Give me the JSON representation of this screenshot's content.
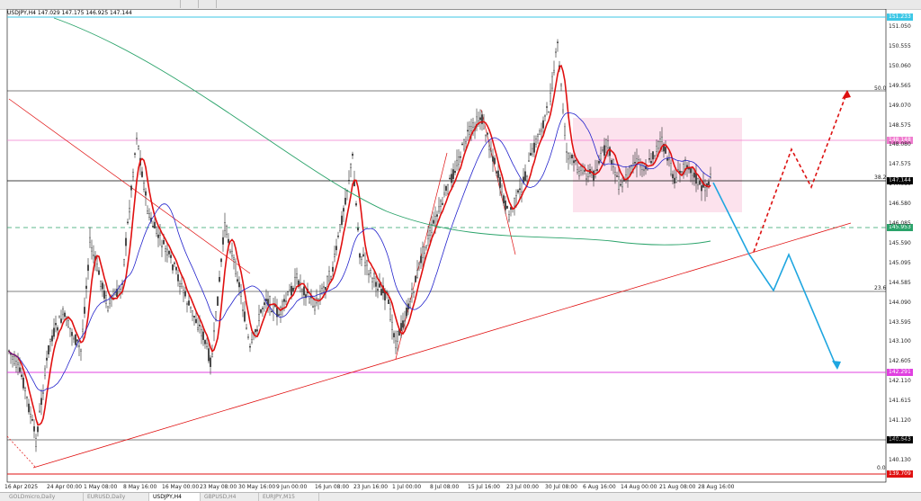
{
  "header": {
    "text": "USDJPY,H4  147.029 147.175 146.925 147.144"
  },
  "price_axis": {
    "labels": [
      "151.050",
      "150.555",
      "150.060",
      "149.565",
      "149.070",
      "148.575",
      "148.080",
      "147.575",
      "147.080",
      "146.580",
      "146.085",
      "145.590",
      "145.095",
      "144.585",
      "144.090",
      "143.595",
      "143.100",
      "142.605",
      "142.110",
      "141.615",
      "141.120",
      "140.625",
      "140.130"
    ]
  },
  "price_tags": {
    "top": "151.233",
    "pink": "148.148",
    "current": "147.144",
    "green": "145.953",
    "magenta": "142.291",
    "black": "140.643",
    "red": "139.709"
  },
  "fib_labels": {
    "f50": "50.0",
    "f38": "38.2",
    "f23": "23.6",
    "f0": "0.0"
  },
  "time_axis": {
    "labels": [
      "16 Apr 2025",
      "24 Apr 00:00",
      "1 May 08:00",
      "8 May 16:00",
      "16 May 00:00",
      "23 May 08:00",
      "30 May 16:00",
      "9 Jun 00:00",
      "16 Jun 08:00",
      "23 Jun 16:00",
      "1 Jul 00:00",
      "8 Jul 08:00",
      "15 Jul 16:00",
      "23 Jul 00:00",
      "30 Jul 08:00",
      "6 Aug 16:00",
      "14 Aug 00:00",
      "21 Aug 08:00",
      "28 Aug 16:00"
    ]
  },
  "tabs": [
    {
      "label": "GOLDmicro,Daily",
      "active": false
    },
    {
      "label": "EURUSD,Daily",
      "active": false
    },
    {
      "label": "USDJPY,H4",
      "active": true
    },
    {
      "label": "GBPUSD,H4",
      "active": false
    },
    {
      "label": "EURJPY,M15",
      "active": false
    }
  ],
  "colors": {
    "candles": "#444444",
    "ma_fast": "#e01010",
    "ma_mid": "#2222cc",
    "ma_slow": "#2aa36a",
    "projection_up": "#dd1111",
    "projection_down": "#1fa6e0",
    "box": "#fbd6e6"
  }
}
